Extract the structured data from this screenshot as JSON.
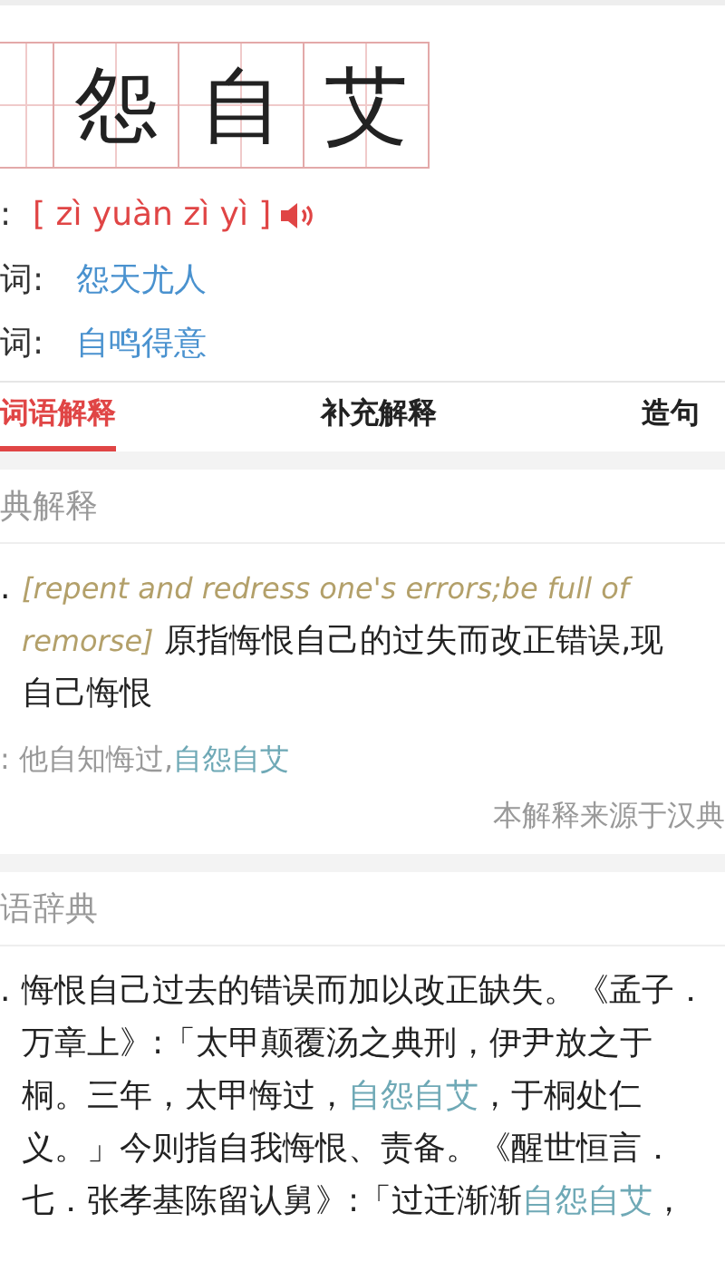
{
  "characters": [
    "怨",
    "自",
    "艾"
  ],
  "pinyin": {
    "label": ":",
    "value": "[ zì yuàn zì yì ]"
  },
  "relations": [
    {
      "label": "词:",
      "value": "怨天尤人"
    },
    {
      "label": "词:",
      "value": "自鸣得意"
    }
  ],
  "tabs": [
    {
      "label": "词语解释",
      "selected": true
    },
    {
      "label": "补充解释",
      "selected": false
    },
    {
      "label": "造句",
      "selected": false
    }
  ],
  "sections": [
    {
      "title": "典解释",
      "number": ".",
      "lines": [
        [
          {
            "kind": "english",
            "text": "[repent and redress one's errors;be full of"
          }
        ],
        [
          {
            "kind": "english",
            "text": "remorse]"
          },
          {
            "kind": "plain",
            "text": " 原指悔恨自己的过失而改正错误,现"
          }
        ],
        [
          {
            "kind": "plain",
            "text": "自己悔恨"
          }
        ]
      ],
      "example": [
        {
          "kind": "muted",
          "text": ": 他自知悔过,"
        },
        {
          "kind": "highlight",
          "text": "自怨自艾"
        }
      ],
      "source": "本解释来源于汉典"
    },
    {
      "title": "语辞典",
      "number": ".",
      "lines": [
        [
          {
            "kind": "plain",
            "text": "悔恨自己过去的错误而加以改正缺失。《孟子．"
          }
        ],
        [
          {
            "kind": "plain",
            "text": "万章上》:「太甲颠覆汤之典刑，伊尹放之于"
          }
        ],
        [
          {
            "kind": "plain",
            "text": "桐。三年，太甲悔过，"
          },
          {
            "kind": "highlight",
            "text": "自怨自艾"
          },
          {
            "kind": "plain",
            "text": "，于桐处仁"
          }
        ],
        [
          {
            "kind": "plain",
            "text": "义。」今则指自我悔恨、责备。《醒世恒言．"
          }
        ],
        [
          {
            "kind": "plain",
            "text": "七．张孝基陈留认舅》:「过迁渐渐"
          },
          {
            "kind": "highlight",
            "text": "自怨自艾"
          },
          {
            "kind": "plain",
            "text": "，"
          }
        ]
      ]
    }
  ]
}
